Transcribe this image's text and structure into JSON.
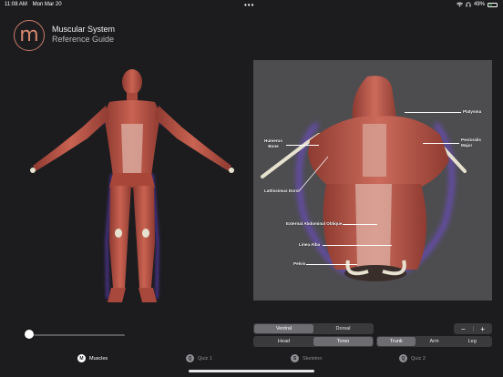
{
  "status": {
    "time": "11:08 AM",
    "date": "Mon Mar 20",
    "battery": "49%",
    "battery_level": 0.49
  },
  "app": {
    "logo_letter": "m",
    "title": "Muscular System",
    "subtitle": "Reference Guide"
  },
  "slider": {
    "value": 0.0
  },
  "detail": {
    "labels": {
      "platysma": "Platysma",
      "pectoralis_major": [
        "Pectoralis",
        "Major"
      ],
      "humerus_bone": [
        "Humerus",
        "Bone"
      ],
      "latissimus_dorsi": "Lattissimus Dorsi",
      "external_oblique": "External Abdominal Oblique",
      "linea_alba": "Linea Alba",
      "pelvis": "Pelvis"
    }
  },
  "controls": {
    "view": {
      "options": [
        "Ventral",
        "Dorsal"
      ],
      "selected": "Ventral"
    },
    "region": {
      "options": [
        "Head",
        "Torso",
        "Trunk",
        "Arm",
        "Leg"
      ],
      "selected": [
        "Torso",
        "Trunk"
      ]
    },
    "zoom": {
      "minus": "−",
      "plus": "+"
    }
  },
  "tabs": [
    {
      "label": "Muscles",
      "icon": "M",
      "active": true
    },
    {
      "label": "Quiz 1",
      "icon": "Q",
      "active": false
    },
    {
      "label": "Skeleton",
      "icon": "S",
      "active": false
    },
    {
      "label": "Quiz 2",
      "icon": "Q",
      "active": false
    }
  ],
  "colors": {
    "muscle": "#b34a3e",
    "muscle_highlight": "#d9796a",
    "bone": "#e6e2cf",
    "glow": "#7b4cff",
    "panel_bg": "#4d4d4f",
    "accent": "#c77b68"
  }
}
